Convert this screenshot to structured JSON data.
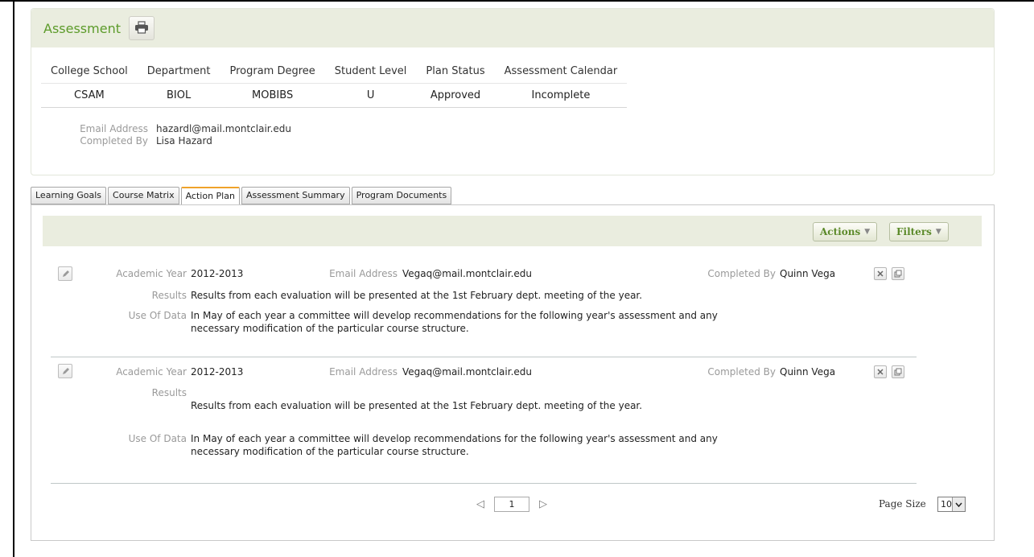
{
  "assessment": {
    "title": "Assessment",
    "print_icon": "printer-icon",
    "summary": {
      "headers": [
        "College School",
        "Department",
        "Program Degree",
        "Student Level",
        "Plan Status",
        "Assessment Calendar"
      ],
      "values": [
        "CSAM",
        "BIOL",
        "MOBIBS",
        "U",
        "Approved",
        "Incomplete"
      ]
    },
    "meta": {
      "email_label": "Email Address",
      "email_value": "hazardl@mail.montclair.edu",
      "completed_label": "Completed By",
      "completed_value": "Lisa Hazard"
    }
  },
  "tabs": [
    {
      "label": "Learning Goals",
      "active": false
    },
    {
      "label": "Course Matrix",
      "active": false
    },
    {
      "label": "Action Plan",
      "active": true
    },
    {
      "label": "Assessment Summary",
      "active": false
    },
    {
      "label": "Program Documents",
      "active": false
    }
  ],
  "toolbar": {
    "actions_label": "Actions",
    "filters_label": "Filters"
  },
  "labels": {
    "academic_year": "Academic Year",
    "email_address": "Email Address",
    "completed_by": "Completed By",
    "results": "Results",
    "use_of_data": "Use Of Data"
  },
  "entries": [
    {
      "academic_year": "2012-2013",
      "email": "Vegaq@mail.montclair.edu",
      "completed_by": "Quinn Vega",
      "results": "Results from each evaluation will be presented at the 1st February dept. meeting of the year.",
      "use_of_data_line1": "In May of each year a committee will develop recommendations for the following year's assessment and any",
      "use_of_data_line2": "necessary modification of the particular course structure."
    },
    {
      "academic_year": "2012-2013",
      "email": "Vegaq@mail.montclair.edu",
      "completed_by": "Quinn Vega",
      "results": "Results from each evaluation will be presented at the 1st February dept. meeting of the year.",
      "use_of_data_line1": "In May of each year a committee will develop recommendations for the following year's assessment and any",
      "use_of_data_line2": "necessary modification of the particular course structure."
    }
  ],
  "pager": {
    "current_page": "1",
    "page_size_label": "Page Size",
    "page_size_value": "10"
  },
  "colors": {
    "accent_green": "#5c9b2a",
    "header_bg": "#eaeddf",
    "active_tab_border": "#f0a22a"
  }
}
